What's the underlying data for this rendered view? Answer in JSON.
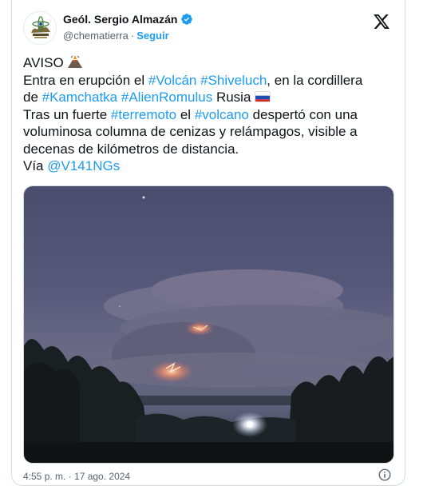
{
  "author": {
    "name": "Geól. Sergio Almazán",
    "handle": "@chematierra",
    "separator": "·",
    "follow_label": "Seguir"
  },
  "tweet": {
    "line1": "AVISO",
    "line2_pre": "Entra en erupción el ",
    "tag_volcan": "#Volcán",
    "space1": " ",
    "tag_shiveluch": "#Shiveluch",
    "line2_post": ", en la cordillera",
    "line3_pre": "de ",
    "tag_kamchatka": "#Kamchatka",
    "tag_alien": "#AlienRomulus",
    "line3_post": " Rusia ",
    "line4_pre": "Tras un fuerte ",
    "tag_terremoto": "#terremoto",
    "line4_mid": " el ",
    "tag_volcano": "#volcano",
    "line4_post": " despertó con una",
    "line5": "voluminosa columna de cenizas y relámpagos, visible a",
    "line6": "decenas de kilómetros de distancia.",
    "line7_pre": "Vía ",
    "mention": "@V141NGs"
  },
  "footer": {
    "timestamp": "4:55 p. m. · 17 ago. 2024"
  },
  "icons": {
    "volcano": "volcano-emoji-icon",
    "flag": "russia-flag-icon",
    "verified": "verified-badge-icon",
    "brand": "x-logo-icon",
    "info": "info-icon"
  },
  "colors": {
    "link": "#1d9bf0",
    "text": "#0f1419",
    "secondary": "#536471"
  }
}
